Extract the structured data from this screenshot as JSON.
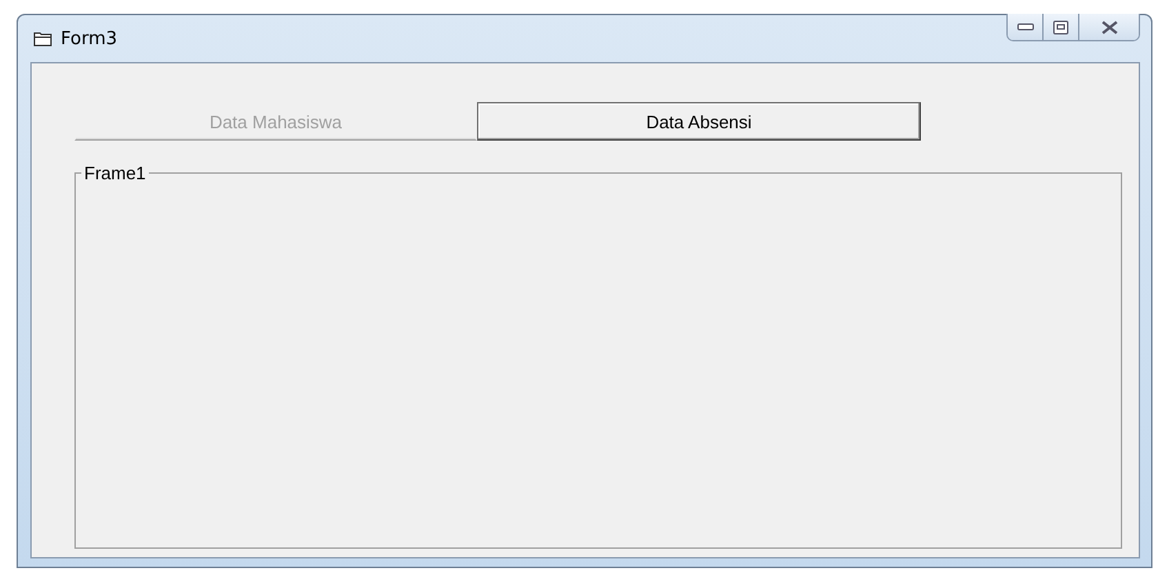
{
  "window": {
    "title": "Form3"
  },
  "buttons": [
    {
      "label": "Data Mahasiswa",
      "disabled": true
    },
    {
      "label": "Data Absensi",
      "disabled": false
    }
  ],
  "frame": {
    "caption": "Frame1"
  }
}
